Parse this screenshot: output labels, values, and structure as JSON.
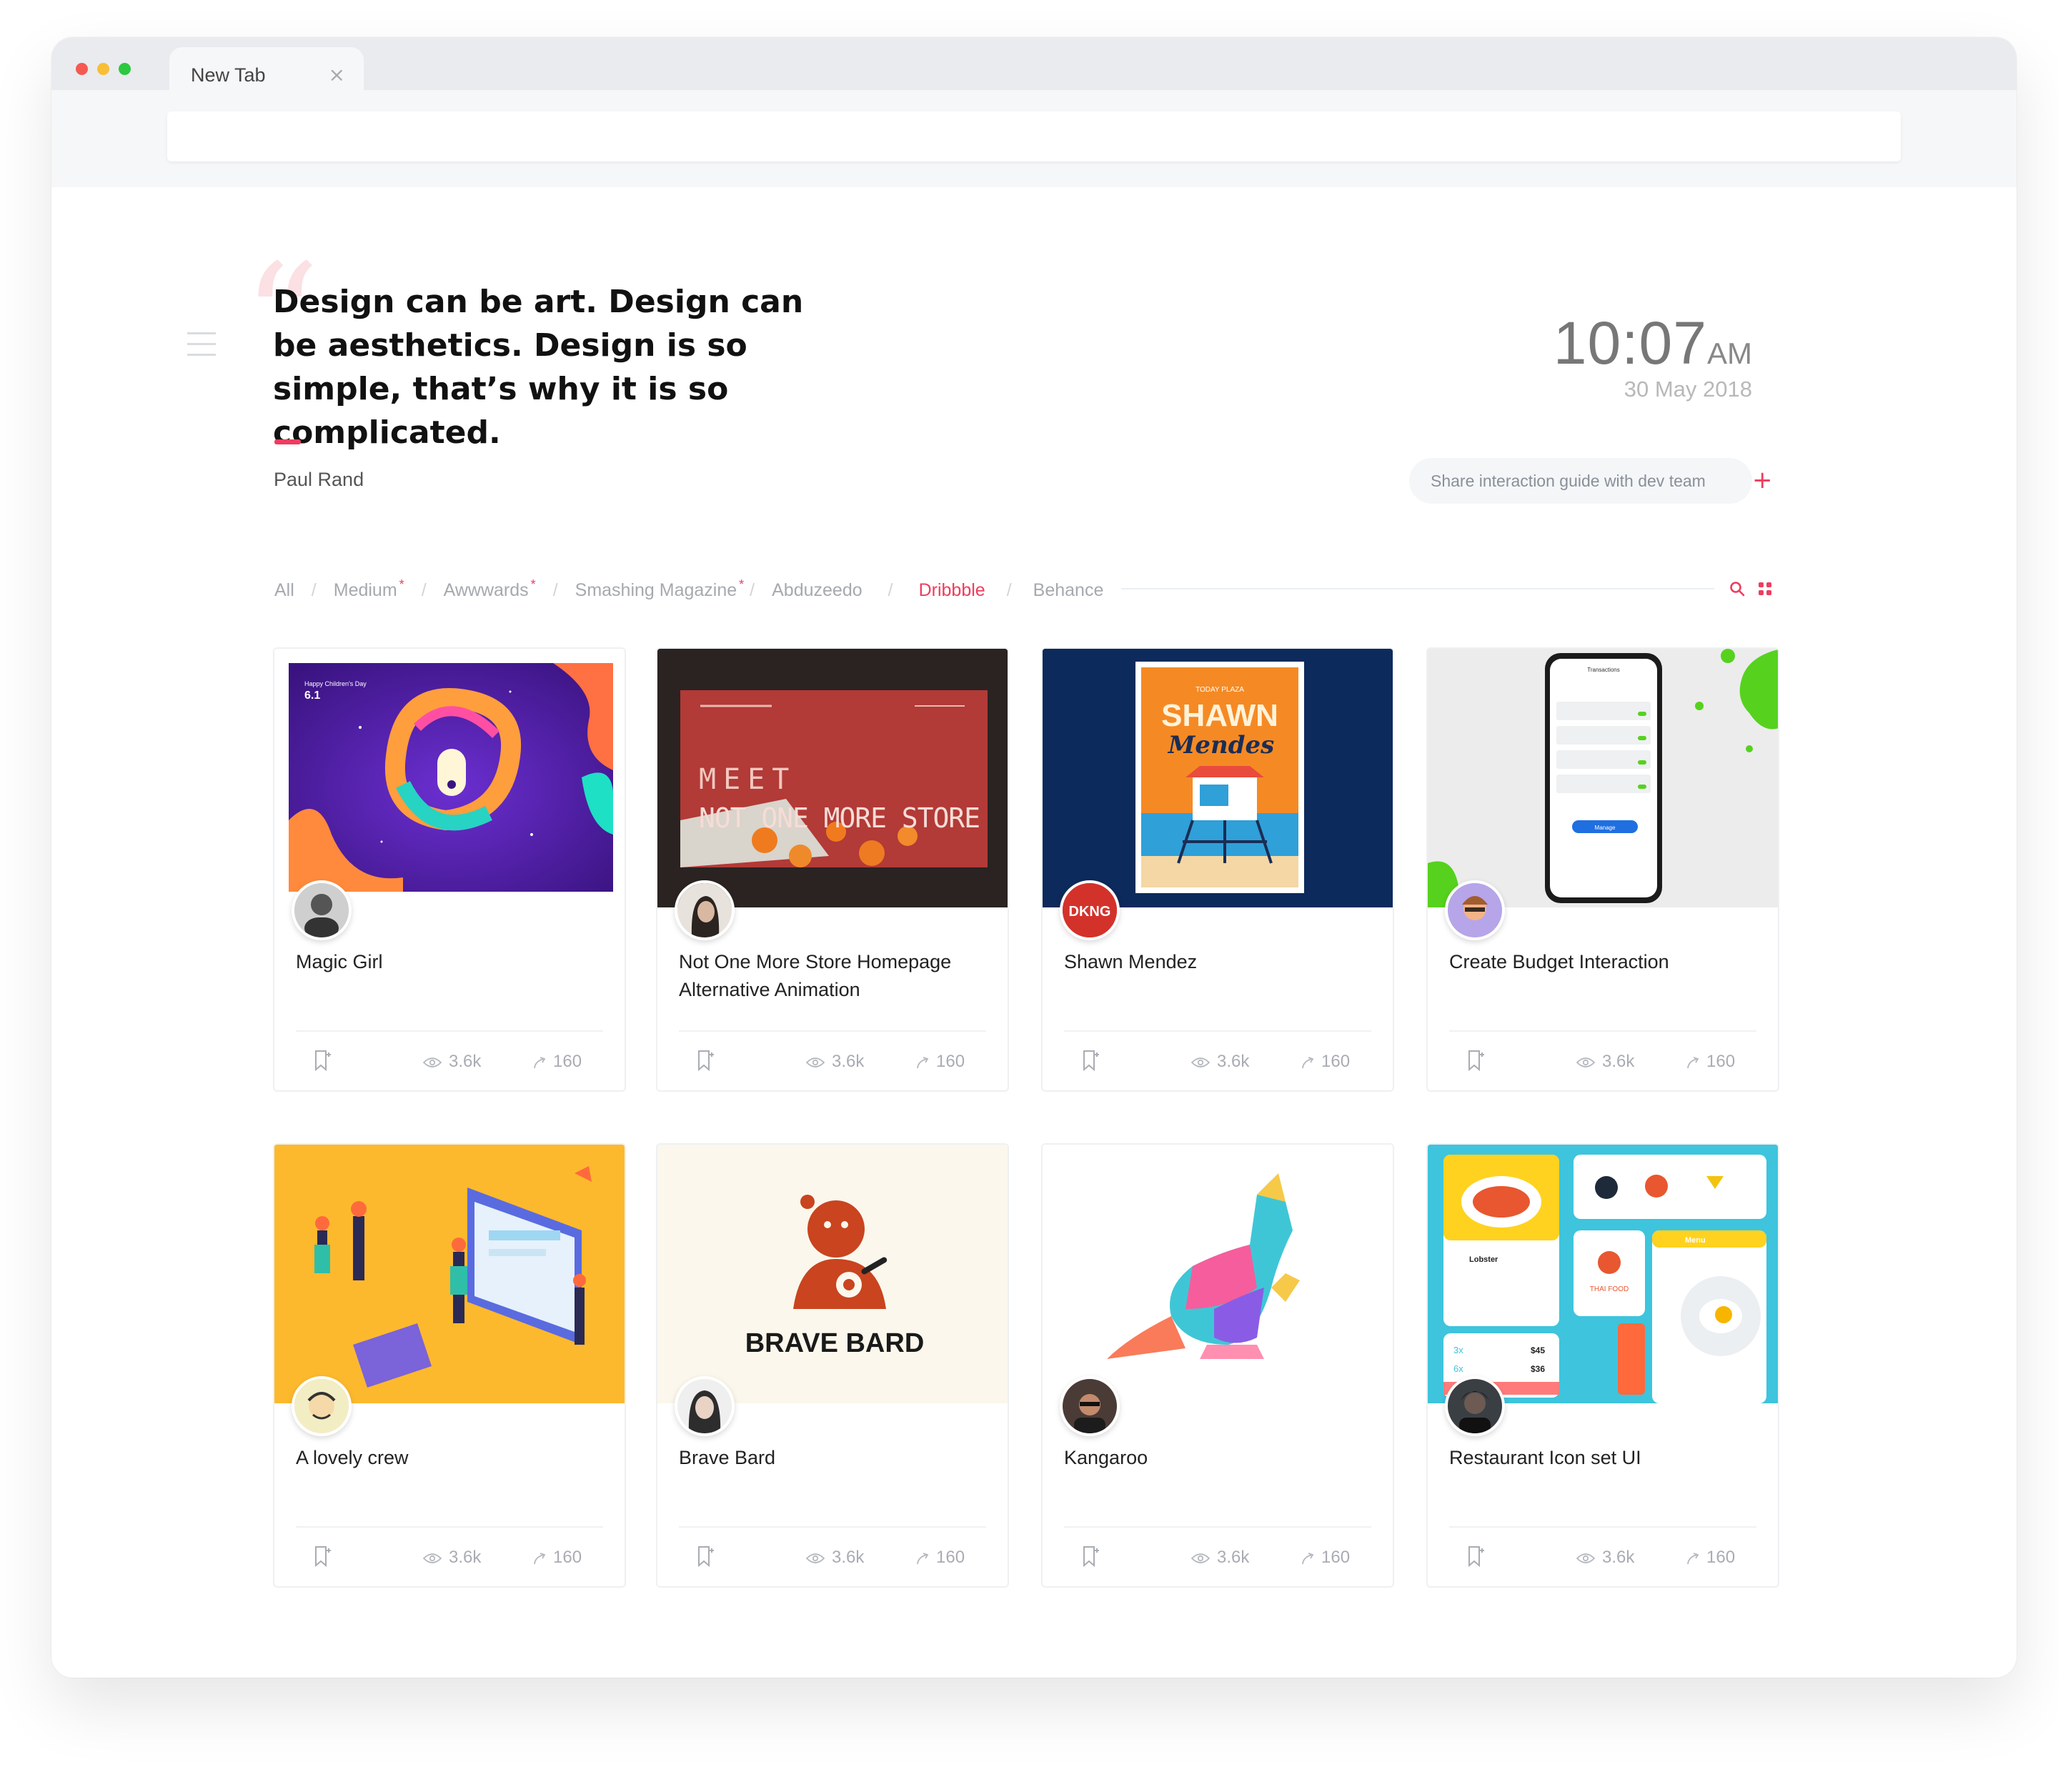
{
  "browser": {
    "tab_title": "New Tab",
    "tab_close": "×",
    "dot_colors": [
      "#f45a52",
      "#f8be35",
      "#2cc840"
    ]
  },
  "quote": {
    "text": "Design can be art. Design can be aesthetics. Design is so simple, that’s why it is so complicated.",
    "author": "Paul Rand",
    "accent_color": "#ee3d5e"
  },
  "clock": {
    "time": "10:07",
    "ampm": "AM",
    "date": "30 May 2018"
  },
  "share": {
    "label": "Share interaction guide with dev team",
    "plus": "+"
  },
  "filters": [
    {
      "label": "All",
      "star": ""
    },
    {
      "label": "Medium",
      "star": "*"
    },
    {
      "label": "Awwwards",
      "star": "*"
    },
    {
      "label": "Smashing Magazine",
      "star": "*"
    },
    {
      "label": "Abduzeedo",
      "star": ""
    },
    {
      "label": "Dribbble",
      "star": "",
      "active": true
    },
    {
      "label": "Behance",
      "star": ""
    }
  ],
  "cards": [
    {
      "title": "Magic Girl",
      "views": "3.6k",
      "shares": "160"
    },
    {
      "title": "Not One More Store Homepage Alternative Animation",
      "views": "3.6k",
      "shares": "160"
    },
    {
      "title": "Shawn Mendez",
      "views": "3.6k",
      "shares": "160",
      "avatar_text": "DKNG"
    },
    {
      "title": "Create Budget Interaction",
      "views": "3.6k",
      "shares": "160"
    },
    {
      "title": "A lovely crew",
      "views": "3.6k",
      "shares": "160"
    },
    {
      "title": "Brave Bard",
      "views": "3.6k",
      "shares": "160"
    },
    {
      "title": "Kangaroo",
      "views": "3.6k",
      "shares": "160"
    },
    {
      "title": "Restaurant Icon set UI",
      "views": "3.6k",
      "shares": "160"
    }
  ],
  "thumb_text": {
    "magic_day": "Happy Children's Day",
    "magic_date": "6.1",
    "store_line1": "MEET",
    "store_line2": "NOT ONE MORE STORE",
    "shawn_top": "TODAY PLAZA",
    "shawn_title": "SHAWN",
    "shawn_script": "Mendes",
    "budget_header": "Transactions",
    "budget_button": "Manage",
    "brave_bard": "BRAVE BARD",
    "restaurant_item": "Lobster",
    "restaurant_menu": "Menu",
    "restaurant_price1": "$45",
    "restaurant_price2": "$36",
    "restaurant_qty1": "3x",
    "restaurant_qty2": "6x",
    "restaurant_thai": "THAI FOOD"
  }
}
